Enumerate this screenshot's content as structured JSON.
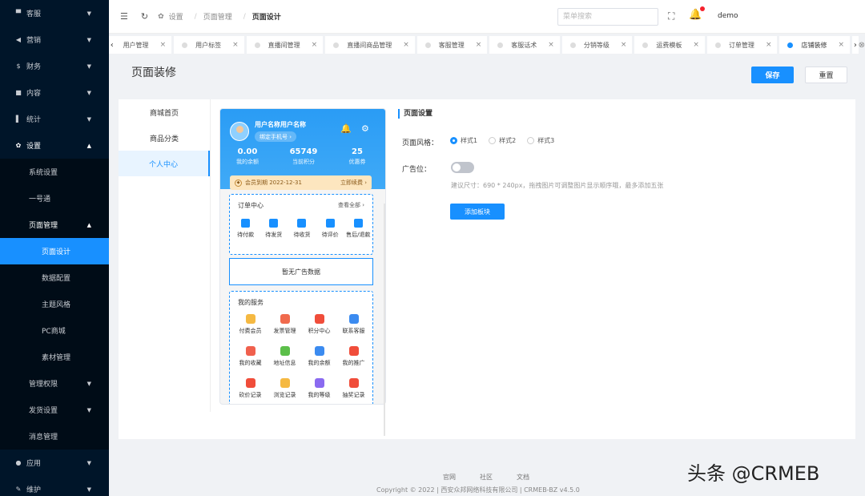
{
  "sidebar": {
    "items": [
      {
        "icon": "chat-icon",
        "glyph": "▀",
        "label": "客服"
      },
      {
        "icon": "send-icon",
        "glyph": "◀",
        "label": "营销"
      },
      {
        "icon": "dollar-icon",
        "glyph": "$",
        "label": "财务"
      },
      {
        "icon": "content-icon",
        "glyph": "■",
        "label": "内容"
      },
      {
        "icon": "stats-icon",
        "glyph": "▌",
        "label": "统计"
      },
      {
        "icon": "gear-icon",
        "glyph": "✿",
        "label": "设置"
      }
    ],
    "settings_sub": [
      "系统设置",
      "一号通",
      "页面管理"
    ],
    "page_sub": [
      "页面设计",
      "数据配置",
      "主题风格",
      "PC商城",
      "素材管理"
    ],
    "settings_sub2": [
      "管理权限",
      "发货设置",
      "消息管理"
    ],
    "bottom_items": [
      {
        "icon": "app-icon",
        "glyph": "●",
        "label": "应用"
      },
      {
        "icon": "wrench-icon",
        "glyph": "✎",
        "label": "维护"
      }
    ]
  },
  "header": {
    "breadcrumb": [
      "设置",
      "页面管理",
      "页面设计"
    ],
    "search_placeholder": "菜单搜索",
    "user": "demo"
  },
  "tabs": [
    {
      "label": "用户管理",
      "dot": false
    },
    {
      "label": "用户标签",
      "dot": true
    },
    {
      "label": "直播间管理",
      "dot": true
    },
    {
      "label": "直播间商品管理",
      "dot": true
    },
    {
      "label": "客服管理",
      "dot": true
    },
    {
      "label": "客服话术",
      "dot": true
    },
    {
      "label": "分销等级",
      "dot": true
    },
    {
      "label": "运费模板",
      "dot": true
    },
    {
      "label": "订单管理",
      "dot": true
    },
    {
      "label": "店铺装修",
      "dot": true,
      "active": true
    }
  ],
  "page": {
    "title": "页面装修",
    "save_label": "保存",
    "reset_label": "重置"
  },
  "left_nav": [
    "商城首页",
    "商品分类",
    "个人中心"
  ],
  "phone": {
    "user_name": "用户名称用户名称",
    "bind_phone": "绑定手机号 ›",
    "stats": [
      {
        "value": "0.00",
        "label": "我的余额"
      },
      {
        "value": "65749",
        "label": "当前积分"
      },
      {
        "value": "25",
        "label": "优惠券"
      }
    ],
    "vip_text": "会员到期 2022-12-31",
    "vip_renew": "立即续费 ›",
    "order_title": "订单中心",
    "order_more": "查看全部 ›",
    "orders": [
      "待付款",
      "待发货",
      "待收货",
      "待评价",
      "售后/退款"
    ],
    "ad_empty": "暂无广告数据",
    "service_title": "我的服务",
    "services": [
      {
        "label": "付费会员",
        "color": "#f5b942"
      },
      {
        "label": "发票管理",
        "color": "#f06a4d"
      },
      {
        "label": "积分中心",
        "color": "#f04d3a"
      },
      {
        "label": "联系客服",
        "color": "#3b8bf0"
      },
      {
        "label": "我的收藏",
        "color": "#f0604d"
      },
      {
        "label": "地址信息",
        "color": "#5cbf4a"
      },
      {
        "label": "我的余额",
        "color": "#3b8bf0"
      },
      {
        "label": "我的推广",
        "color": "#f04d3a"
      },
      {
        "label": "砍价记录",
        "color": "#f04d3a"
      },
      {
        "label": "浏览记录",
        "color": "#f5b942"
      },
      {
        "label": "我的等级",
        "color": "#8a6af0"
      },
      {
        "label": "抽奖记录",
        "color": "#f04d3a"
      }
    ]
  },
  "settings": {
    "title": "页面设置",
    "style_label": "页面风格：",
    "style_options": [
      "样式1",
      "样式2",
      "样式3"
    ],
    "ad_label": "广告位：",
    "hint": "建议尺寸：690 * 240px，拖拽图片可调整图片显示顺序哦，最多添加五张",
    "add_button": "添加板块"
  },
  "footer": {
    "links": [
      "官网",
      "社区",
      "文档"
    ],
    "copyright": "Copyright © 2022 | 西安众邦网络科技有限公司 | CRMEB-BZ v4.5.0"
  },
  "watermark": "头条 @CRMEB",
  "colors": {
    "primary": "#1890ff",
    "sidebar_bg": "#001529"
  }
}
